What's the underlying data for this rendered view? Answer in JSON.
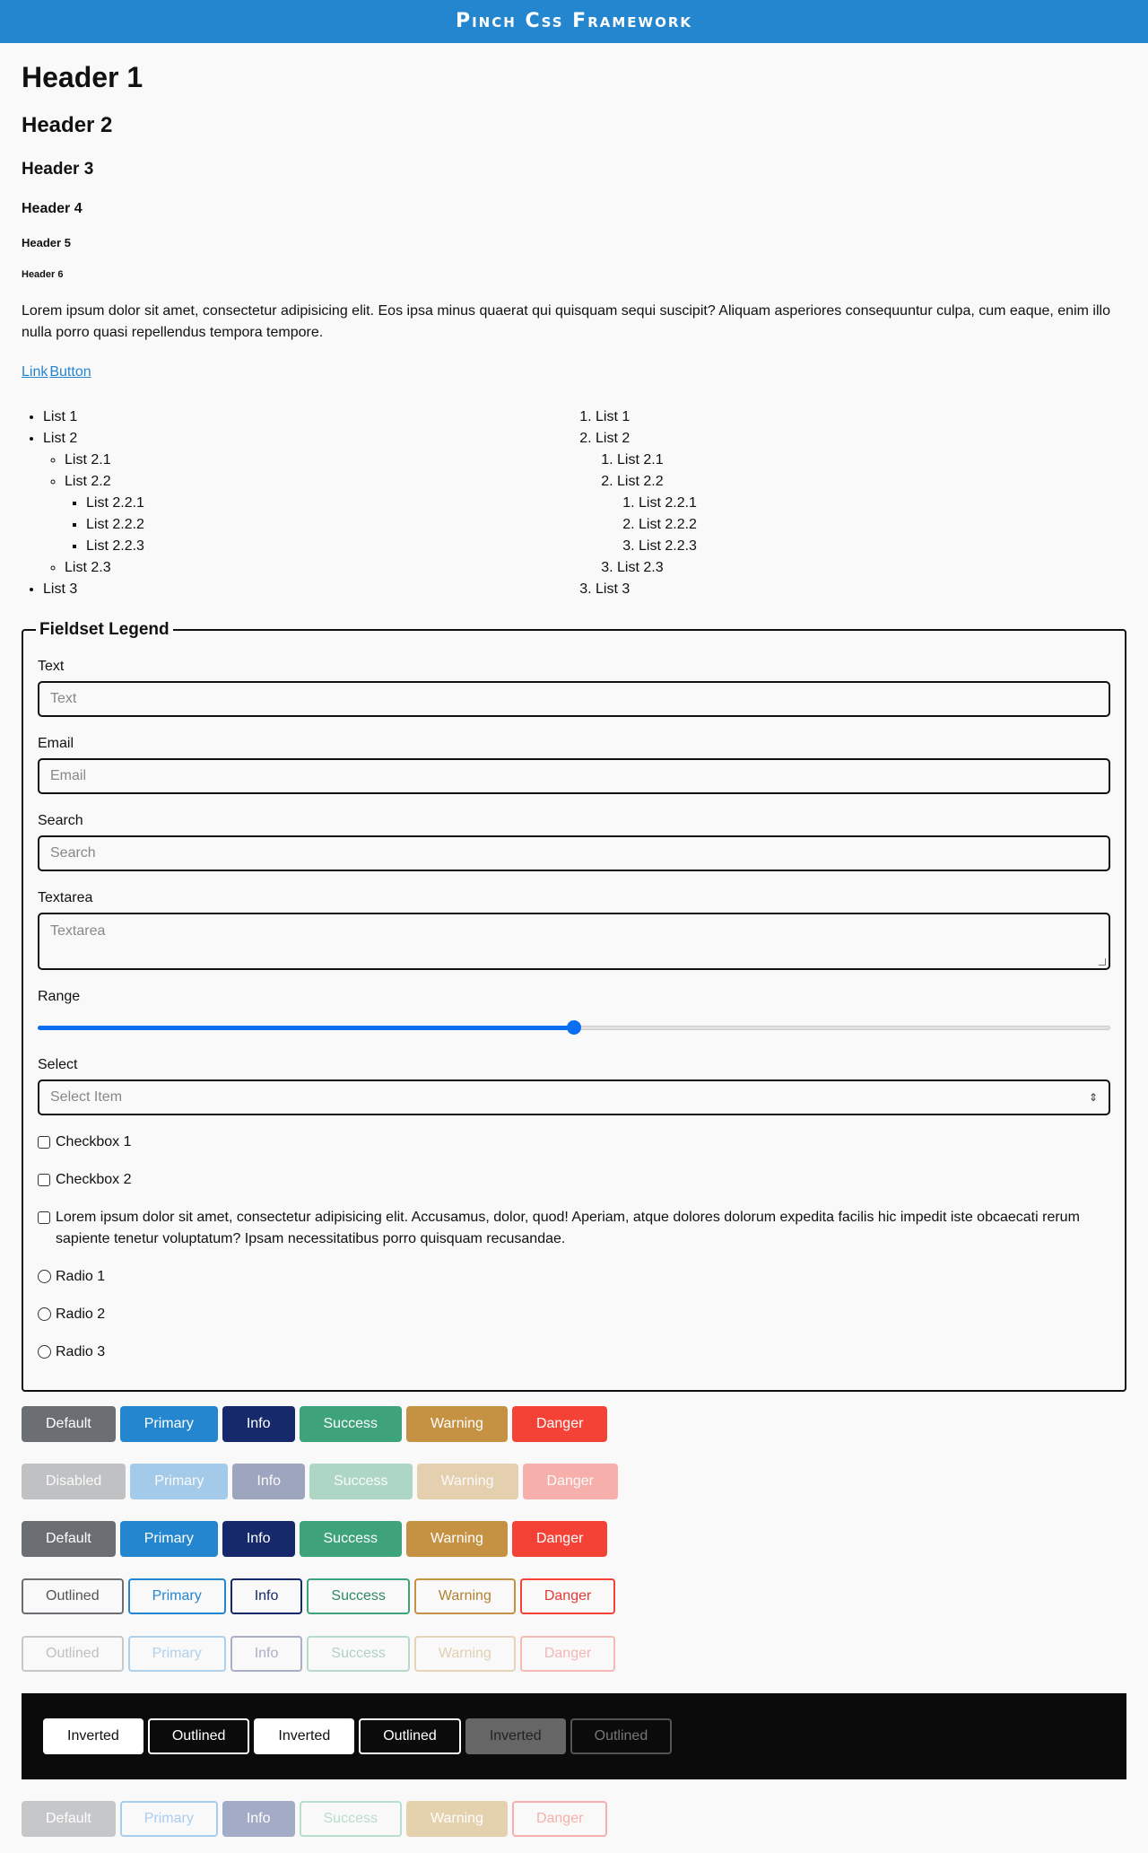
{
  "title": "Pinch Css Framework",
  "headers": {
    "h1": "Header 1",
    "h2": "Header 2",
    "h3": "Header 3",
    "h4": "Header 4",
    "h5": "Header 5",
    "h6": "Header 6"
  },
  "paragraph": "Lorem ipsum dolor sit amet, consectetur adipisicing elit. Eos ipsa minus quaerat qui quisquam sequi suscipit? Aliquam asperiores consequuntur culpa, cum eaque, enim illo nulla porro quasi repellendus tempora tempore.",
  "links": {
    "link": "Link",
    "button": "Button"
  },
  "lists": {
    "l1": "List 1",
    "l2": "List 2",
    "l21": "List 2.1",
    "l22": "List 2.2",
    "l221": "List 2.2.1",
    "l222": "List 2.2.2",
    "l223": "List 2.2.3",
    "l23": "List 2.3",
    "l3": "List 3"
  },
  "fieldset": {
    "legend": "Fieldset Legend",
    "text_label": "Text",
    "text_placeholder": "Text",
    "email_label": "Email",
    "email_placeholder": "Email",
    "search_label": "Search",
    "search_placeholder": "Search",
    "textarea_label": "Textarea",
    "textarea_placeholder": "Textarea",
    "range_label": "Range",
    "range_value": 0.5,
    "select_label": "Select",
    "select_value": "Select Item",
    "checkbox1": "Checkbox 1",
    "checkbox2": "Checkbox 2",
    "checkbox3": "Lorem ipsum dolor sit amet, consectetur adipisicing elit. Accusamus, dolor, quod! Aperiam, atque dolores dolorum expedita facilis hic impedit iste obcaecati rerum sapiente tenetur voluptatum? Ipsam necessitatibus porro quisquam recusandae.",
    "radio1": "Radio 1",
    "radio2": "Radio 2",
    "radio3": "Radio 3"
  },
  "buttons": {
    "default": "Default",
    "disabled": "Disabled",
    "primary": "Primary",
    "info": "Info",
    "success": "Success",
    "warning": "Warning",
    "danger": "Danger",
    "outlined": "Outlined",
    "inverted": "Inverted"
  },
  "colors": {
    "brand": "#2586d0",
    "default": "#6b6e73",
    "info": "#16296a",
    "success": "#3ea37a",
    "warning": "#c59243",
    "danger": "#f44336",
    "range": "#0b6ef0"
  }
}
